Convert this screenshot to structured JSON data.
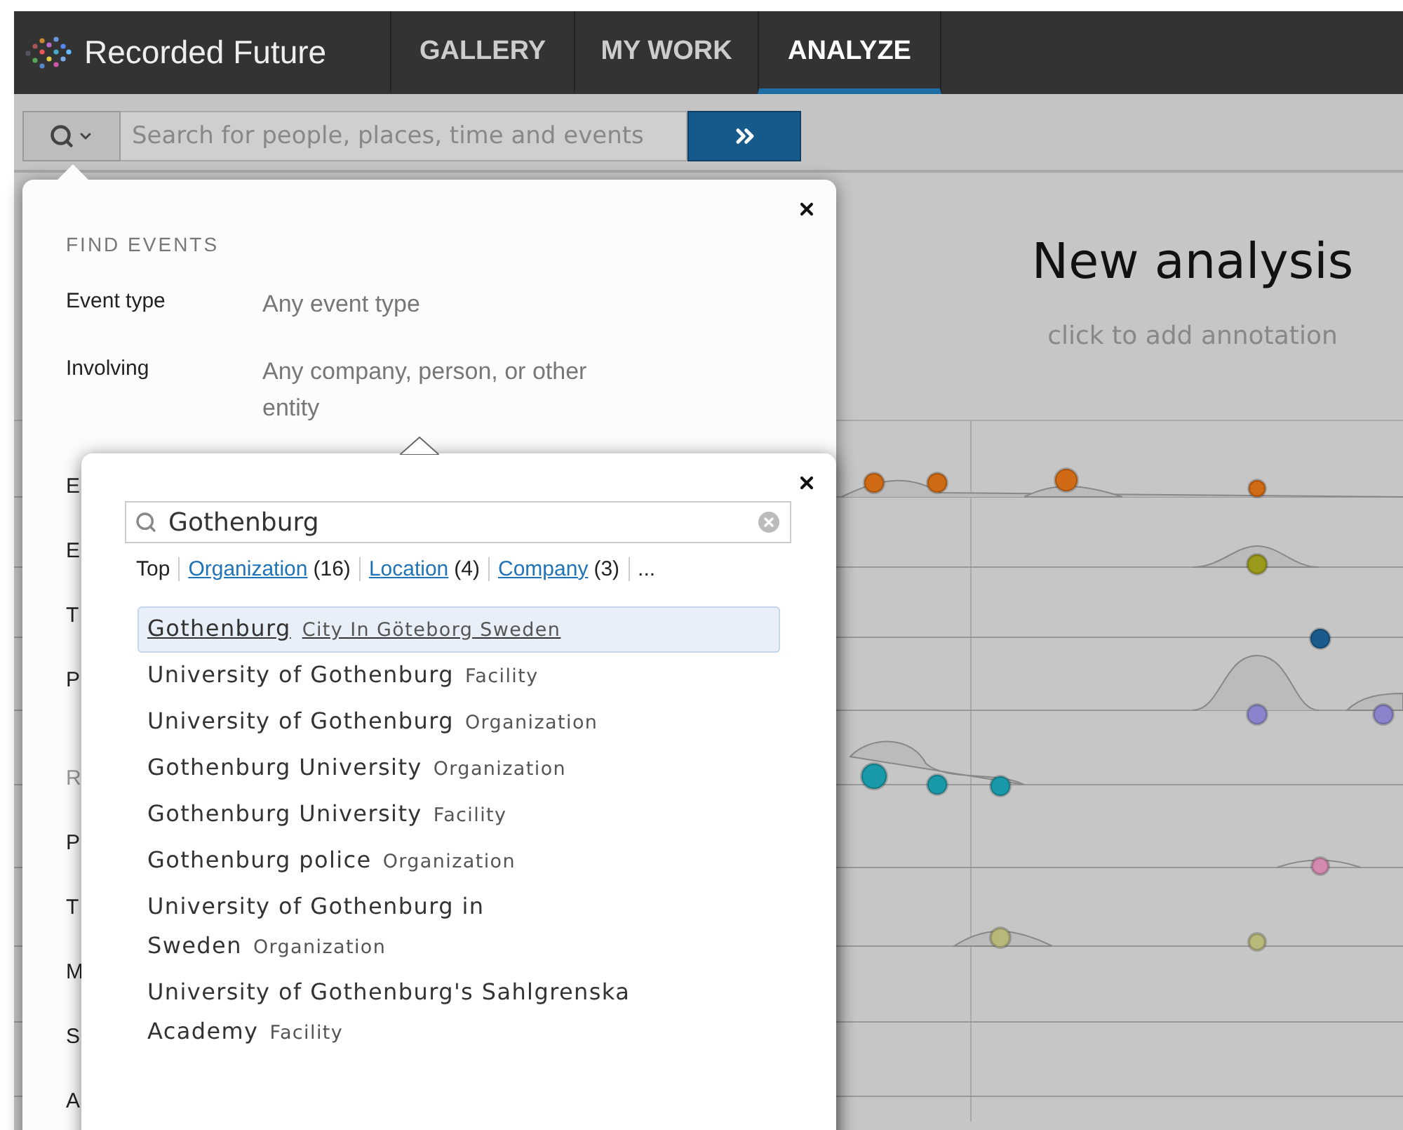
{
  "header": {
    "logo": "Recorded Future",
    "tabs": [
      {
        "label": "GALLERY",
        "selected": false
      },
      {
        "label": "MY WORK",
        "selected": false
      },
      {
        "label": "ANALYZE",
        "selected": true
      }
    ]
  },
  "toolbar": {
    "search_placeholder": "Search for people, places, time and events"
  },
  "analysis": {
    "title": "New analysis",
    "annotation_hint": "click to add annotation"
  },
  "find_events": {
    "heading": "FIND EVENTS",
    "fields": [
      {
        "label": "Event type",
        "value": "Any event type"
      },
      {
        "label": "Involving",
        "value": "Any company, person, or other entity"
      }
    ],
    "covered_rows": [
      {
        "text": "E",
        "kind": "label"
      },
      {
        "text": "E",
        "kind": "label"
      },
      {
        "text": "T",
        "kind": "label"
      },
      {
        "text": "P",
        "kind": "label"
      },
      {
        "text": "R",
        "kind": "heading"
      },
      {
        "text": "P",
        "kind": "label"
      },
      {
        "text": "T",
        "kind": "label"
      },
      {
        "text": "M",
        "kind": "label"
      },
      {
        "text": "S",
        "kind": "label"
      },
      {
        "text": "A",
        "kind": "label"
      }
    ]
  },
  "entity_picker": {
    "query": "Gothenburg",
    "filters": [
      {
        "label": "Top",
        "kind": "plain"
      },
      {
        "label": "Organization",
        "count": "(16)",
        "kind": "link"
      },
      {
        "label": "Location",
        "count": "(4)",
        "kind": "link"
      },
      {
        "label": "Company",
        "count": "(3)",
        "kind": "link"
      },
      {
        "label": "...",
        "kind": "plain"
      }
    ],
    "results": [
      {
        "name": "Gothenburg",
        "type": "City In Göteborg Sweden",
        "selected": true
      },
      {
        "name": "University of Gothenburg",
        "type": "Facility",
        "selected": false
      },
      {
        "name": "University of Gothenburg",
        "type": "Organization",
        "selected": false
      },
      {
        "name": "Gothenburg University",
        "type": "Organization",
        "selected": false
      },
      {
        "name": "Gothenburg University",
        "type": "Facility",
        "selected": false
      },
      {
        "name": "Gothenburg police",
        "type": "Organization",
        "selected": false
      },
      {
        "name": "University of Gothenburg in Sweden",
        "type": "Organization",
        "selected": false
      },
      {
        "name": "University of Gothenburg's Sahlgrenska Academy",
        "type": "Facility",
        "selected": false
      }
    ]
  }
}
